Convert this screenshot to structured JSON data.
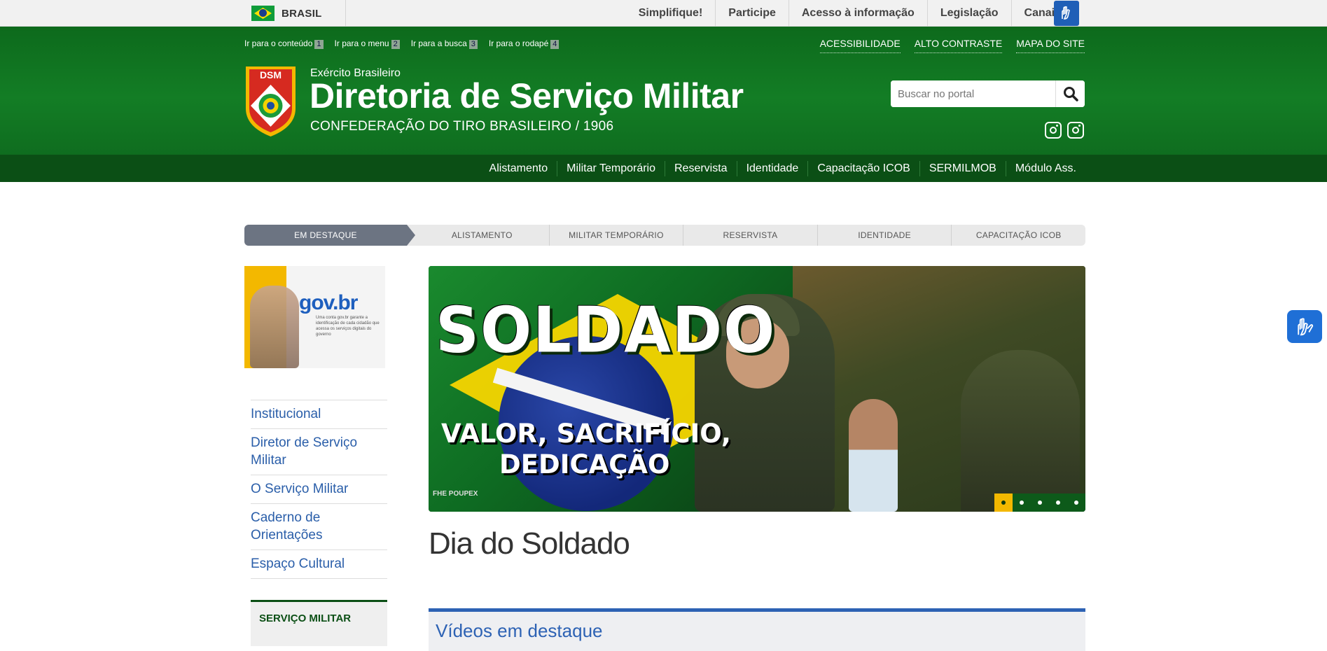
{
  "gov_bar": {
    "country": "BRASIL",
    "links": [
      "Simplifique!",
      "Participe",
      "Acesso à informação",
      "Legislação",
      "Canais"
    ]
  },
  "header": {
    "skip_links": [
      {
        "label": "Ir para o conteúdo",
        "key": "1"
      },
      {
        "label": "Ir para o menu",
        "key": "2"
      },
      {
        "label": "Ir para a busca",
        "key": "3"
      },
      {
        "label": "Ir para o rodapé",
        "key": "4"
      }
    ],
    "access_links": [
      "ACESSIBILIDADE",
      "ALTO CONTRASTE",
      "MAPA DO SITE"
    ],
    "logo_text": "DSM",
    "org_small": "Exército Brasileiro",
    "org_title": "Diretoria de Serviço Militar",
    "org_subtitle": "CONFEDERAÇÃO DO TIRO BRASILEIRO / 1906",
    "search_placeholder": "Buscar no portal",
    "social_icons": [
      "instagram-icon",
      "instagram-icon"
    ]
  },
  "main_nav": [
    "Alistamento",
    "Militar Temporário",
    "Reservista",
    "Identidade",
    "Capacitação ICOB",
    "SERMILMOB",
    "Módulo Ass."
  ],
  "tabs": [
    "EM DESTAQUE",
    "ALISTAMENTO",
    "MILITAR TEMPORÁRIO",
    "RESERVISTA",
    "IDENTIDADE",
    "CAPACITAÇÃO ICOB"
  ],
  "active_tab": "EM DESTAQUE",
  "sidebar": {
    "banner_logo": "gov.br",
    "banner_text": "Uma conta gov.br garante a identificação de cada cidadão que acessa os serviços digitais do governo",
    "menu": [
      "Institucional",
      "Diretor de Serviço Militar",
      "O Serviço Militar",
      "Caderno de Orientações",
      "Espaço Cultural"
    ],
    "section_title": "SERVIÇO MILITAR"
  },
  "carousel": {
    "headline": "SOLDADO",
    "tagline_line1": "VALOR, SACRIFÍCIO,",
    "tagline_line2": "DEDICAÇÃO",
    "credit": "FHE POUPEX",
    "dots": 5,
    "active_dot": 1
  },
  "slide_title": "Dia do Soldado",
  "videos_title": "Vídeos em destaque",
  "colors": {
    "header_green": "#137d25",
    "nav_green": "#0b4f15",
    "link_blue": "#2a5ea9",
    "accent_yellow": "#f3b800"
  }
}
